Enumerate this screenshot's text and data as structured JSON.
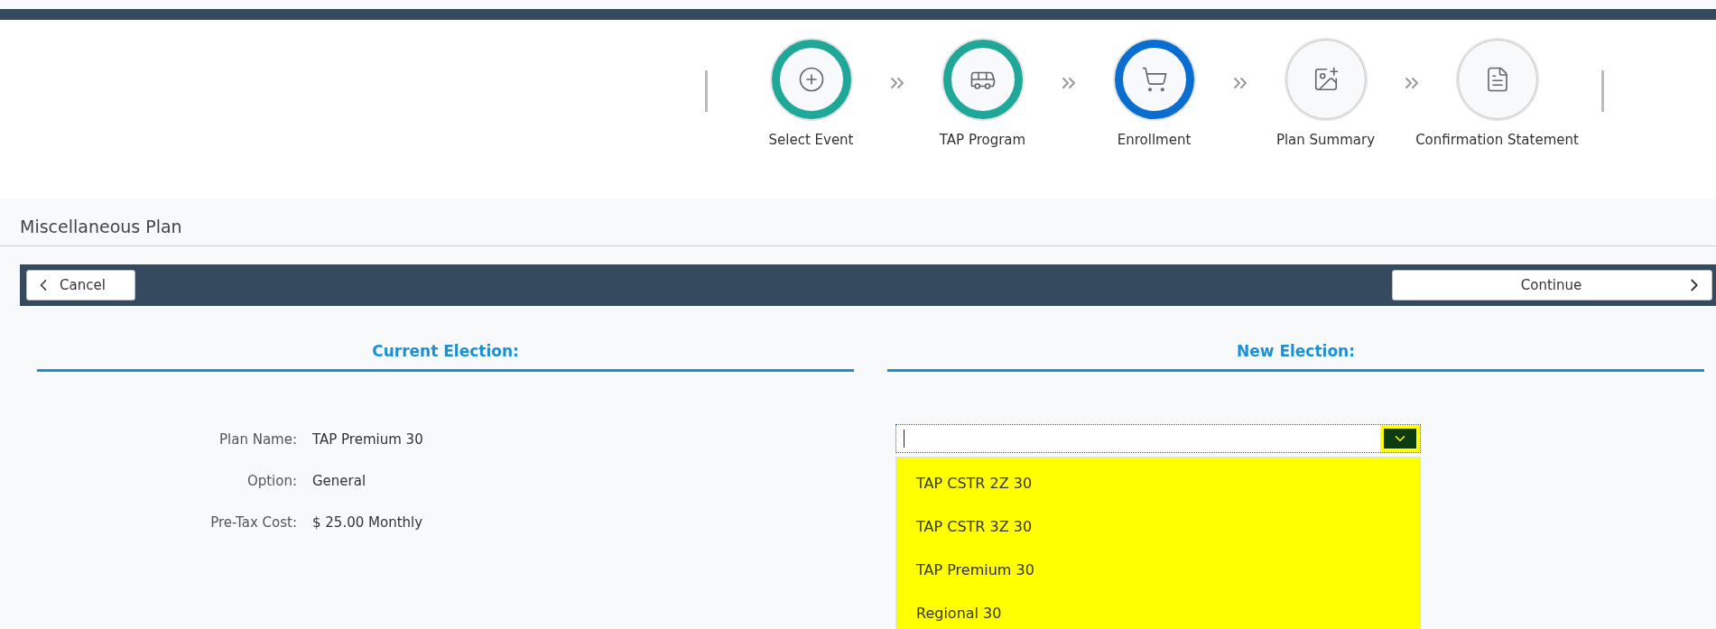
{
  "steps": [
    {
      "label": "Select Event",
      "done": true,
      "current": false
    },
    {
      "label": "TAP Program",
      "done": true,
      "current": false
    },
    {
      "label": "Enrollment",
      "done": false,
      "current": true
    },
    {
      "label": "Plan Summary",
      "done": false,
      "current": false
    },
    {
      "label": "Confirmation Statement",
      "done": false,
      "current": false
    }
  ],
  "page_title": "Miscellaneous Plan",
  "toolbar": {
    "cancel": "Cancel",
    "continue": "Continue"
  },
  "current_election": {
    "heading": "Current Election:",
    "fields": [
      {
        "label": "Plan Name:",
        "value": "TAP Premium 30"
      },
      {
        "label": "Option:",
        "value": "General"
      },
      {
        "label": "Pre-Tax Cost:",
        "value": "$ 25.00 Monthly"
      }
    ]
  },
  "new_election": {
    "heading": "New Election:",
    "dropdown": {
      "expanded": true,
      "options": [
        {
          "label": "TAP CSTR 2Z 30",
          "selected": false
        },
        {
          "label": "TAP CSTR 3Z 30",
          "selected": false
        },
        {
          "label": "TAP Premium 30",
          "selected": false
        },
        {
          "label": "Regional 30",
          "selected": false
        }
      ]
    }
  }
}
